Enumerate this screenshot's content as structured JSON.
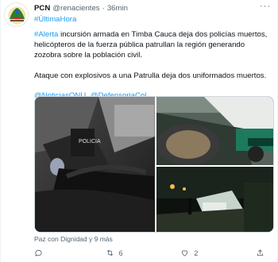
{
  "tweet": {
    "author_name": "PCN",
    "handle": "@renacientes",
    "separator": "·",
    "time": "36min",
    "more": "···",
    "top_hashtag": "#ÚltimaHora",
    "alert_tag": "#Alerta",
    "paragraph1": " incursión armada en Timba Cauca deja dos policías muertos, helicópteros de la fuerza pública patrullan la región generando zozobra sobre la población civil.",
    "paragraph2": "Ataque con explosivos a una Patrulla deja dos uniformados muertos.",
    "mentions": [
      "@NoticiasONU",
      "@DefensoriaCol"
    ],
    "media_caption": "Paz con Dignidad y 9 más"
  },
  "actions": {
    "reply_count": "",
    "retweet_count": "6",
    "like_count": "2"
  },
  "colors": {
    "link": "#1d9bf0",
    "secondary_text": "#536471"
  }
}
